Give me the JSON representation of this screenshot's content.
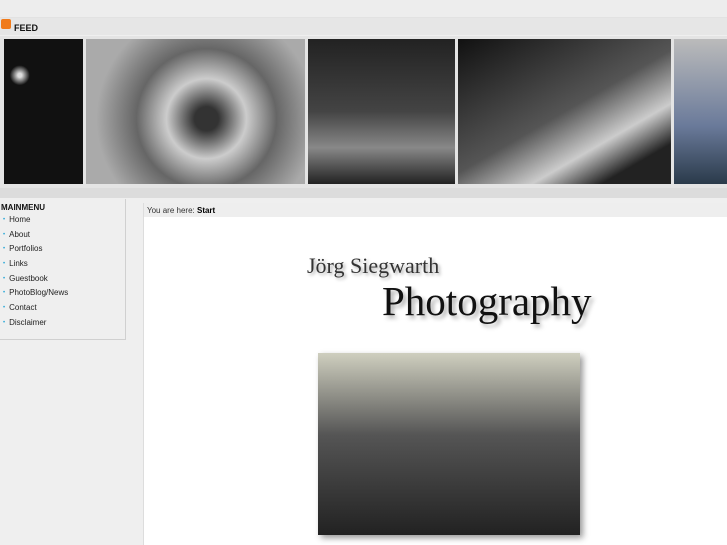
{
  "header": {
    "feed_label": "FEED"
  },
  "menu": {
    "title": "MAINMENU",
    "items": [
      "Home",
      "About",
      "Portfolios",
      "Links",
      "Guestbook",
      "PhotoBlog/News",
      "Contact",
      "Disclaimer"
    ]
  },
  "breadcrumb": {
    "prefix": "You are here:",
    "current": "Start"
  },
  "logo": {
    "line1": "Jörg Siegwarth",
    "line2": "Photography"
  }
}
